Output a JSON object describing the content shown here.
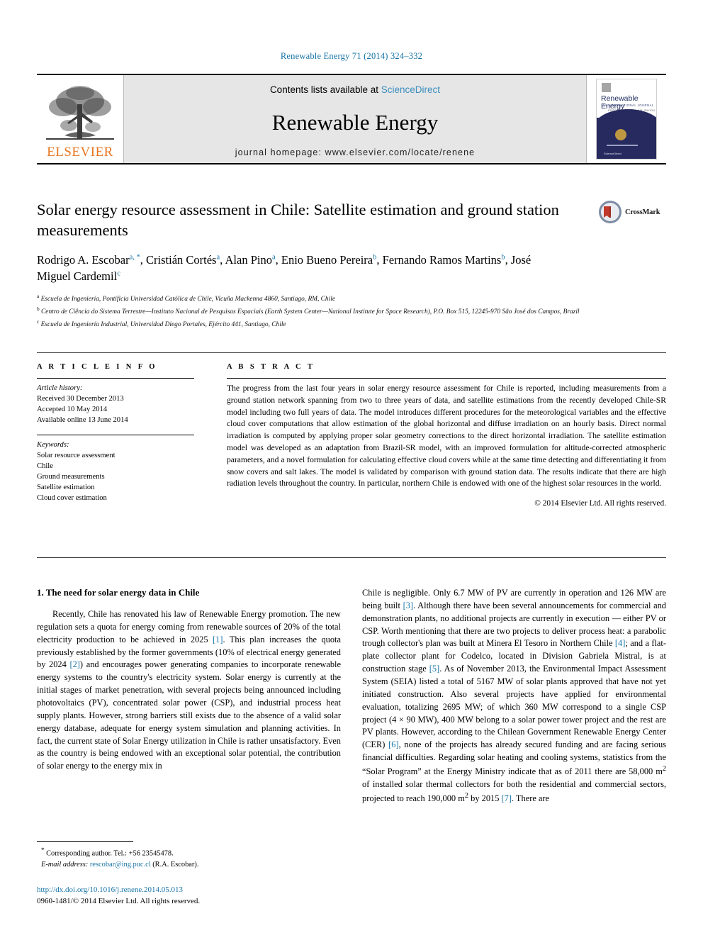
{
  "running_head": "Renewable Energy 71 (2014) 324–332",
  "masthead": {
    "contents_prefix": "Contents lists available at ",
    "sciencedirect": "ScienceDirect",
    "journal_title": "Renewable Energy",
    "homepage": "journal homepage: www.elsevier.com/locate/renene",
    "publisher_wordmark": "ELSEVIER",
    "cover": {
      "title": "Renewable Energy",
      "subtitle": "AN INTERNATIONAL JOURNAL",
      "subtitle2": "EDITOR-IN-CHIEF: A.A.M. SAYIGH",
      "footer": "ScienceDirect"
    }
  },
  "article": {
    "title": "Solar energy resource assessment in Chile: Satellite estimation and ground station measurements",
    "crossmark_label": "CrossMark",
    "authors": [
      {
        "name": "Rodrigo A. Escobar",
        "marks": "a, *"
      },
      {
        "name": "Cristián Cortés",
        "marks": "a"
      },
      {
        "name": "Alan Pino",
        "marks": "a"
      },
      {
        "name": "Enio Bueno Pereira",
        "marks": "b"
      },
      {
        "name": "Fernando Ramos Martins",
        "marks": "b"
      },
      {
        "name": "José Miguel Cardemil",
        "marks": "c"
      }
    ],
    "affiliations": [
      {
        "mark": "a",
        "text": "Escuela de Ingeniería, Pontificia Universidad Católica de Chile, Vicuña Mackenna 4860, Santiago, RM, Chile"
      },
      {
        "mark": "b",
        "text": "Centro de Ciência do Sistema Terrestre—Instituto Nacional de Pesquisas Espaciais (Earth System Center—National Institute for Space Research), P.O. Box 515, 12245-970 São José dos Campos, Brazil"
      },
      {
        "mark": "c",
        "text": "Escuela de Ingeniería Industrial, Universidad Diego Portales, Ejército 441, Santiago, Chile"
      }
    ]
  },
  "article_info": {
    "heading": "A R T I C L E  I N F O",
    "history_label": "Article history:",
    "history": [
      "Received 30 December 2013",
      "Accepted 10 May 2014",
      "Available online 13 June 2014"
    ],
    "keywords_label": "Keywords:",
    "keywords": [
      "Solar resource assessment",
      "Chile",
      "Ground measurements",
      "Satellite estimation",
      "Cloud cover estimation"
    ]
  },
  "abstract": {
    "heading": "A B S T R A C T",
    "text": "The progress from the last four years in solar energy resource assessment for Chile is reported, including measurements from a ground station network spanning from two to three years of data, and satellite estimations from the recently developed Chile-SR model including two full years of data. The model introduces different procedures for the meteorological variables and the effective cloud cover computations that allow estimation of the global horizontal and diffuse irradiation on an hourly basis. Direct normal irradiation is computed by applying proper solar geometry corrections to the direct horizontal irradiation. The satellite estimation model was developed as an adaptation from Brazil-SR model, with an improved formulation for altitude-corrected atmospheric parameters, and a novel formulation for calculating effective cloud covers while at the same time detecting and differentiating it from snow covers and salt lakes. The model is validated by comparison with ground station data. The results indicate that there are high radiation levels throughout the country. In particular, northern Chile is endowed with one of the highest solar resources in the world.",
    "copyright": "© 2014 Elsevier Ltd. All rights reserved."
  },
  "body": {
    "section_number_title": "1.  The need for solar energy data in Chile",
    "left_paragraph_1_part1": "Recently, Chile has renovated his law of Renewable Energy promotion. The new regulation sets a quota for energy coming from renewable sources of 20% of the total electricity production to be achieved in 2025 ",
    "left_cite_1": "[1]",
    "left_paragraph_1_part2": ". This plan increases the quota previously established by the former governments (10% of electrical energy generated by 2024 ",
    "left_cite_2": "[2]",
    "left_paragraph_1_part3": ") and encourages power generating companies to incorporate renewable energy systems to the country's electricity system. Solar energy is currently at the initial stages of market penetration, with several projects being announced including photovoltaics (PV), concentrated solar power (CSP), and industrial process heat supply plants. However, strong barriers still exists due to the absence of a valid solar energy database, adequate for energy system simulation and planning activities. In fact, the current state of Solar Energy utilization in Chile is rather unsatisfactory. Even as the country is being endowed with an exceptional solar potential, the contribution of solar energy to the energy mix in",
    "right_part1": "Chile is negligible. Only 6.7 MW of PV are currently in operation and 126 MW are being built ",
    "right_cite_3": "[3]",
    "right_part2": ". Although there have been several announcements for commercial and demonstration plants, no additional projects are currently in execution — either PV or CSP. Worth mentioning that there are two projects to deliver process heat: a parabolic trough collector's plan was built at Minera El Tesoro in Northern Chile ",
    "right_cite_4": "[4]",
    "right_part3": "; and a flat-plate collector plant for Codelco, located in Division Gabriela Mistral, is at construction stage ",
    "right_cite_5": "[5]",
    "right_part4": ". As of November 2013, the Environmental Impact Assessment System (SEIA) listed a total of 5167 MW of solar plants approved that have not yet initiated construction. Also several projects have applied for environmental evaluation, totalizing 2695 MW; of which 360 MW correspond to a single CSP project (4 × 90 MW), 400 MW belong to a solar power tower project and the rest are PV plants. However, according to the Chilean Government Renewable Energy Center (CER) ",
    "right_cite_6": "[6]",
    "right_part5": ", none of the projects has already secured funding and are facing serious financial difficulties. Regarding solar heating and cooling systems, statistics from the “Solar Program” at the Energy Ministry indicate that as of 2011 there are 58,000 m",
    "right_sup1": "2",
    "right_part6": " of installed solar thermal collectors for both the residential and commercial sectors, projected to reach 190,000 m",
    "right_sup2": "2",
    "right_part7": " by 2015 ",
    "right_cite_7": "[7]",
    "right_part8": ". There are"
  },
  "footnote": {
    "star": "*",
    "corresponding": " Corresponding author. Tel.: +56 23545478.",
    "email_label": "E-mail address:",
    "email": "rescobar@ing.puc.cl",
    "email_owner": " (R.A. Escobar)."
  },
  "doi": {
    "url": "http://dx.doi.org/10.1016/j.renene.2014.05.013",
    "issn_line": "0960-1481/© 2014 Elsevier Ltd. All rights reserved."
  },
  "colors": {
    "link_blue": "#1673a6",
    "elsevier_orange": "#e87722",
    "masthead_grey": "#e6e6e6",
    "cover_navy": "#262a5e",
    "cover_gold": "#d9ab3c"
  }
}
